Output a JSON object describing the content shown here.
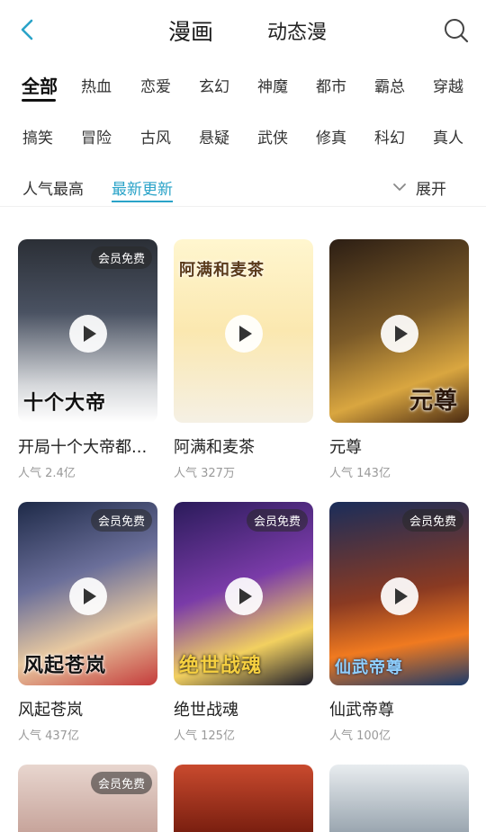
{
  "header": {
    "tabs": [
      {
        "label": "漫画"
      },
      {
        "label": "动态漫"
      }
    ]
  },
  "categories_row1": [
    "全部",
    "热血",
    "恋爱",
    "玄幻",
    "神魔",
    "都市",
    "霸总",
    "穿越"
  ],
  "categories_row2": [
    "搞笑",
    "冒险",
    "古风",
    "悬疑",
    "武侠",
    "修真",
    "科幻",
    "真人"
  ],
  "sort": {
    "options": [
      "人气最高",
      "最新更新"
    ],
    "expand_label": "展开"
  },
  "cards": [
    {
      "title": "开局十个大帝都...",
      "popularity": "人气 2.4亿",
      "badge": "会员免费",
      "cover_text": "十个大帝"
    },
    {
      "title": "阿满和麦茶",
      "popularity": "人气 327万",
      "badge": "",
      "cover_text": "阿满和麦茶"
    },
    {
      "title": "元尊",
      "popularity": "人气 143亿",
      "badge": "",
      "cover_text": "元尊"
    },
    {
      "title": "风起苍岚",
      "popularity": "人气 437亿",
      "badge": "会员免费",
      "cover_text": "风起苍岚"
    },
    {
      "title": "绝世战魂",
      "popularity": "人气 125亿",
      "badge": "会员免费",
      "cover_text": "绝世战魂"
    },
    {
      "title": "仙武帝尊",
      "popularity": "人气 100亿",
      "badge": "会员免费",
      "cover_text": "仙武帝尊"
    },
    {
      "title": "",
      "popularity": "",
      "badge": "会员免费",
      "cover_text": ""
    },
    {
      "title": "",
      "popularity": "",
      "badge": "",
      "cover_text": ""
    },
    {
      "title": "",
      "popularity": "",
      "badge": "",
      "cover_text": ""
    }
  ],
  "colors": {
    "accent": "#2aa3c8",
    "back_icon": "#2aa3c8",
    "muted": "#999999"
  },
  "icons": {
    "back": "chevron-left-icon",
    "search": "search-icon",
    "expand": "chevron-down-icon",
    "play": "play-icon"
  }
}
